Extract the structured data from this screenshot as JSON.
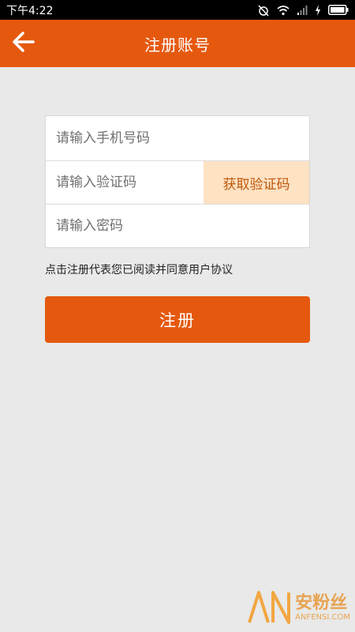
{
  "status_bar": {
    "time": "下午4:22"
  },
  "header": {
    "title": "注册账号",
    "back_icon": "back-arrow-icon"
  },
  "form": {
    "phone_placeholder": "请输入手机号码",
    "code_placeholder": "请输入验证码",
    "get_code_label": "获取验证码",
    "password_placeholder": "请输入密码"
  },
  "agreement_text": "点击注册代表您已阅读并同意用户协议",
  "register_label": "注册",
  "watermark": {
    "cn": "安粉丝",
    "en": "ANFENSI.COM"
  },
  "colors": {
    "accent": "#e5590f",
    "code_button_bg": "#fde2c3",
    "code_button_text": "#c0580a",
    "page_bg": "#e8e9e8"
  }
}
